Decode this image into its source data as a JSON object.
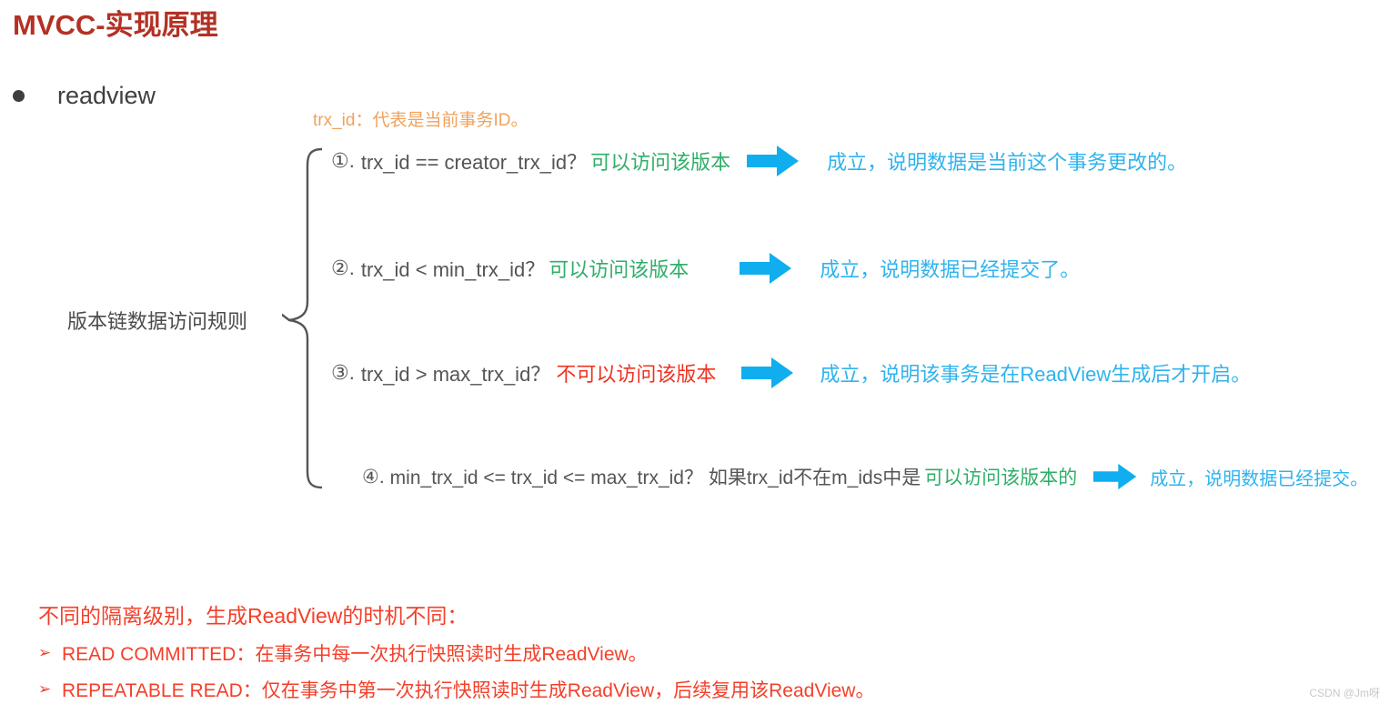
{
  "slide": {
    "title": "MVCC-实现原理",
    "title_color": "#b33124",
    "bullet_label": "readview",
    "trx_note": "trx_id：代表是当前事务ID。",
    "group_label": "版本链数据访问规则",
    "watermark": "CSDN @Jm呀"
  },
  "rules": [
    {
      "index": "①.",
      "condition": "trx_id  == creator_trx_id？",
      "verdict": "可以访问该版本",
      "verdict_type": "allow",
      "verdict_color": "#2fae6a",
      "arrow": "right-arrow-icon",
      "result": "成立，说明数据是当前这个事务更改的。"
    },
    {
      "index": "②.",
      "condition": "trx_id < min_trx_id？",
      "verdict": "可以访问该版本",
      "verdict_type": "allow",
      "verdict_color": "#2fae6a",
      "arrow": "right-arrow-icon",
      "result": "成立，说明数据已经提交了。"
    },
    {
      "index": "③.",
      "condition": "trx_id > max_trx_id？",
      "verdict": "不可以访问该版本",
      "verdict_type": "deny",
      "verdict_color": "#ee3322",
      "arrow": "right-arrow-icon",
      "result": "成立，说明该事务是在ReadView生成后才开启。"
    },
    {
      "index": "④.",
      "condition": "min_trx_id <= trx_id <= max_trx_id？ 如果trx_id不在m_ids中是",
      "verdict": "可以访问该版本的",
      "verdict_type": "allow",
      "verdict_color": "#2fae6a",
      "arrow": "right-arrow-icon",
      "result": "成立，说明数据已经提交。"
    }
  ],
  "bottom": {
    "heading": "不同的隔离级别，生成ReadView的时机不同：",
    "heading_color": "#f3402a",
    "items": [
      {
        "marker": "➢",
        "text": "READ COMMITTED：在事务中每一次执行快照读时生成ReadView。"
      },
      {
        "marker": "➢",
        "text": "REPEATABLE READ：仅在事务中第一次执行快照读时生成ReadView，后续复用该ReadView。"
      }
    ]
  },
  "colors": {
    "arrow": "#10aeef",
    "condition_text": "#555555",
    "result_text": "#2fb3ee"
  }
}
